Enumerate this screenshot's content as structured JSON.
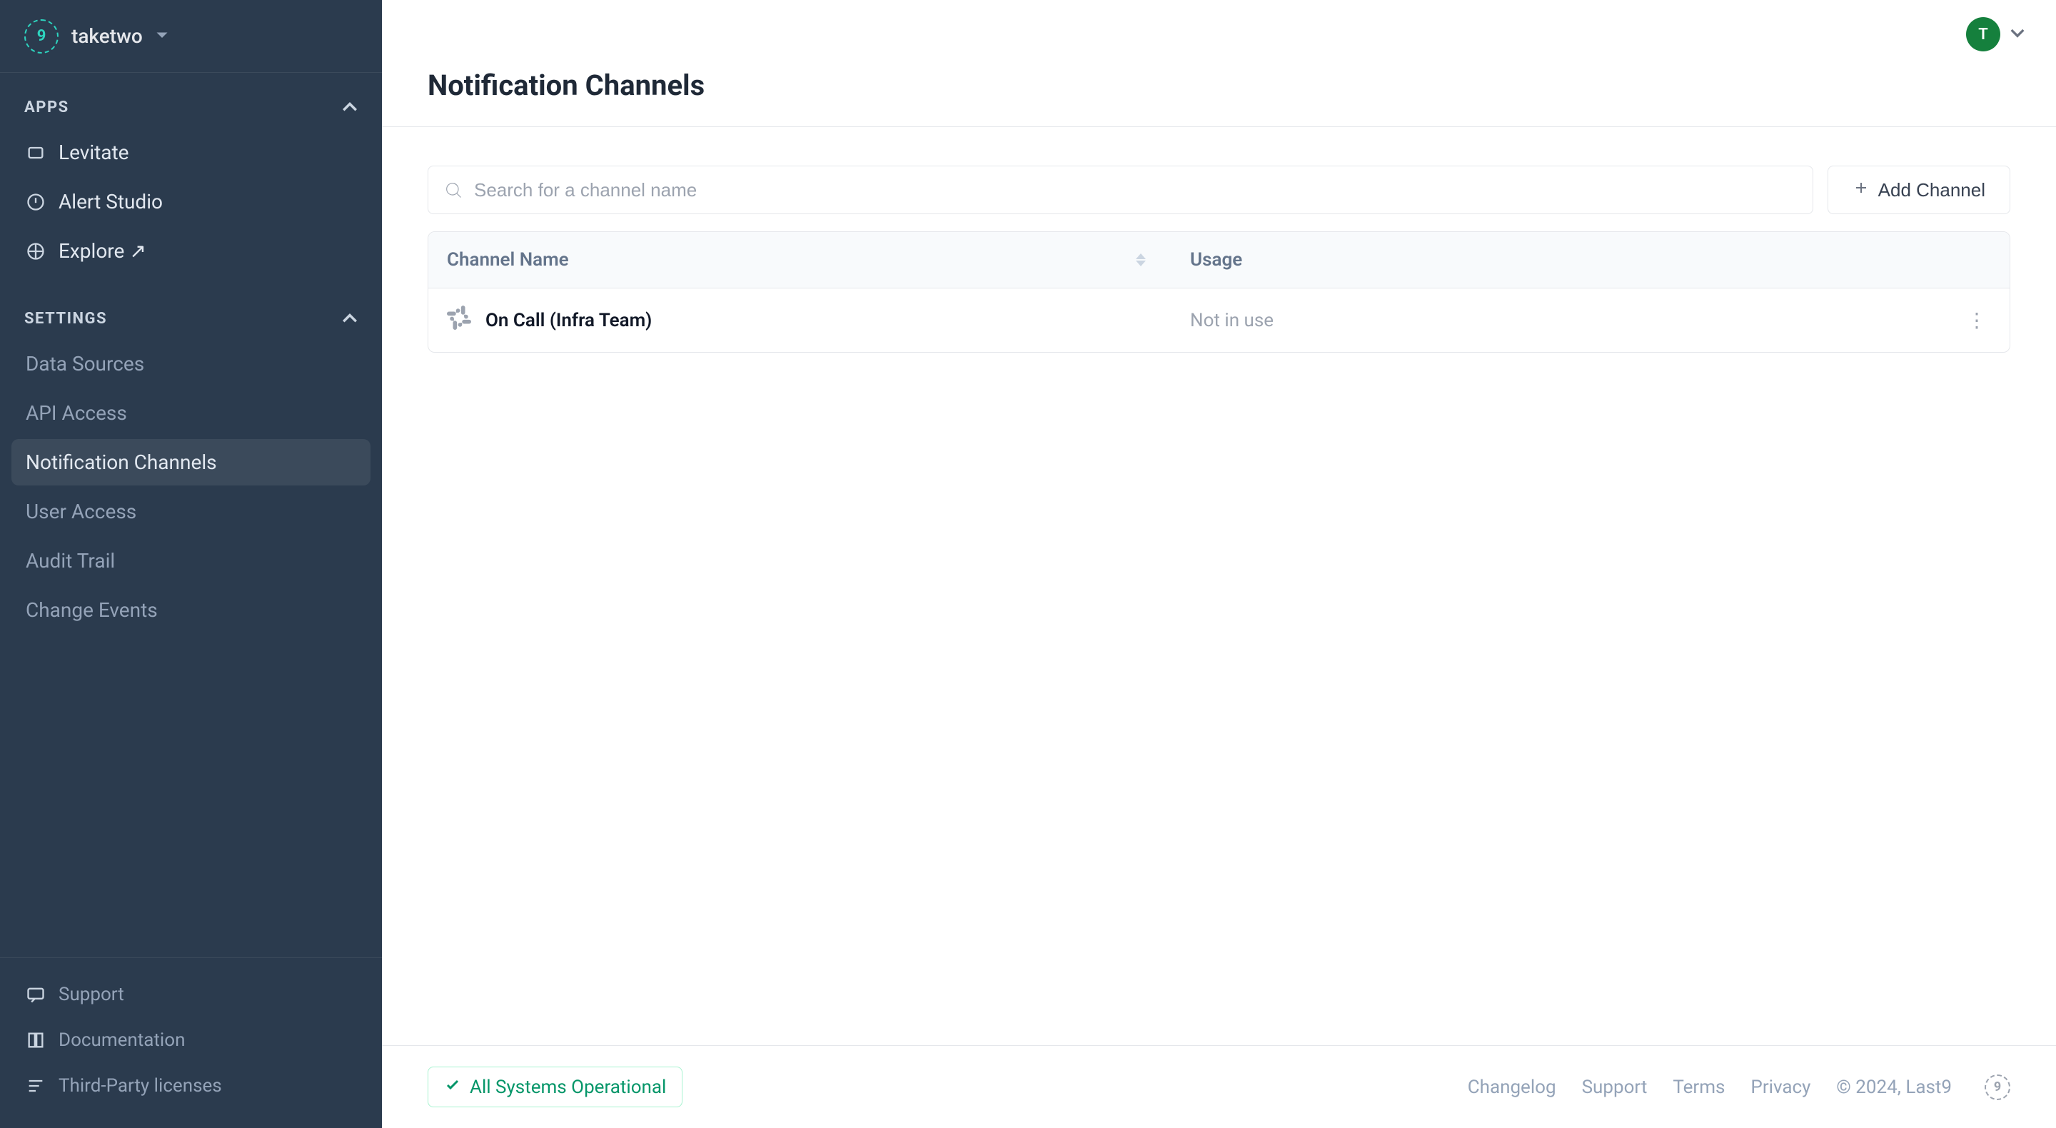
{
  "header": {
    "org_name": "taketwo",
    "avatar_letter": "T"
  },
  "sidebar": {
    "sections": {
      "apps": {
        "label": "APPS",
        "items": [
          {
            "label": "Levitate",
            "icon": "layers-icon"
          },
          {
            "label": "Alert Studio",
            "icon": "alert-icon"
          },
          {
            "label": "Explore ↗",
            "icon": "explore-icon"
          }
        ]
      },
      "settings": {
        "label": "SETTINGS",
        "items": [
          {
            "label": "Data Sources"
          },
          {
            "label": "API Access"
          },
          {
            "label": "Notification Channels",
            "active": true
          },
          {
            "label": "User Access"
          },
          {
            "label": "Audit Trail"
          },
          {
            "label": "Change Events"
          }
        ]
      }
    },
    "bottom": [
      {
        "label": "Support",
        "icon": "message-icon"
      },
      {
        "label": "Documentation",
        "icon": "book-icon"
      },
      {
        "label": "Third-Party licenses",
        "icon": "list-icon"
      }
    ]
  },
  "page": {
    "title": "Notification Channels",
    "search_placeholder": "Search for a channel name",
    "add_button": "Add Channel",
    "columns": {
      "name": "Channel Name",
      "usage": "Usage"
    },
    "rows": [
      {
        "icon": "slack-icon",
        "name": "On Call (Infra Team)",
        "usage": "Not in use"
      }
    ]
  },
  "footer": {
    "status": "All Systems Operational",
    "links": {
      "changelog": "Changelog",
      "support": "Support",
      "terms": "Terms",
      "privacy": "Privacy"
    },
    "copyright": "© 2024, Last9"
  }
}
